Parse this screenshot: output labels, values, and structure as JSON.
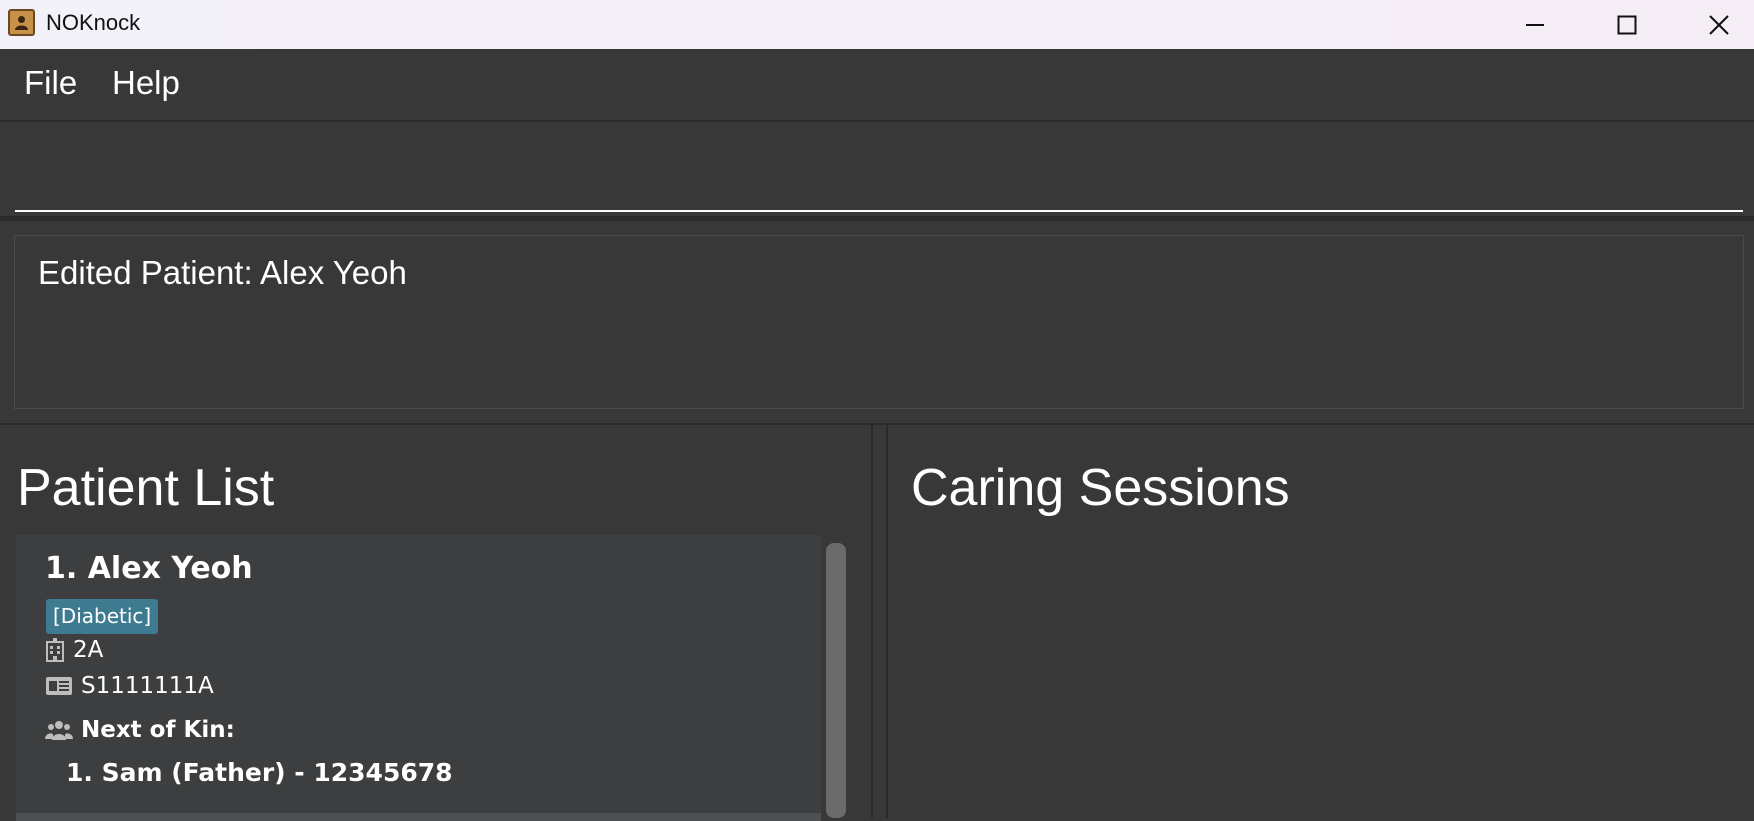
{
  "window": {
    "title": "NOKnock",
    "icon": "app-contact-icon",
    "controls": [
      "minimize-icon",
      "maximize-icon",
      "close-icon"
    ]
  },
  "menu": {
    "file": "File",
    "help": "Help"
  },
  "command": {
    "value": "",
    "placeholder": ""
  },
  "result": {
    "message": "Edited Patient: Alex Yeoh"
  },
  "patient_list": {
    "title": "Patient List",
    "patients": [
      {
        "index_name": "1. Alex Yeoh",
        "tags": [
          "[Diabetic]"
        ],
        "ward": "2A",
        "ic": "S1111111A",
        "nok_label": "Next of Kin:",
        "next_of_kin": [
          "1. Sam (Father) - 12345678"
        ]
      }
    ]
  },
  "caring_sessions": {
    "title": "Caring Sessions"
  },
  "colors": {
    "background": "#383838",
    "card": "#3c3e3f",
    "tag": "#3e7b91"
  }
}
